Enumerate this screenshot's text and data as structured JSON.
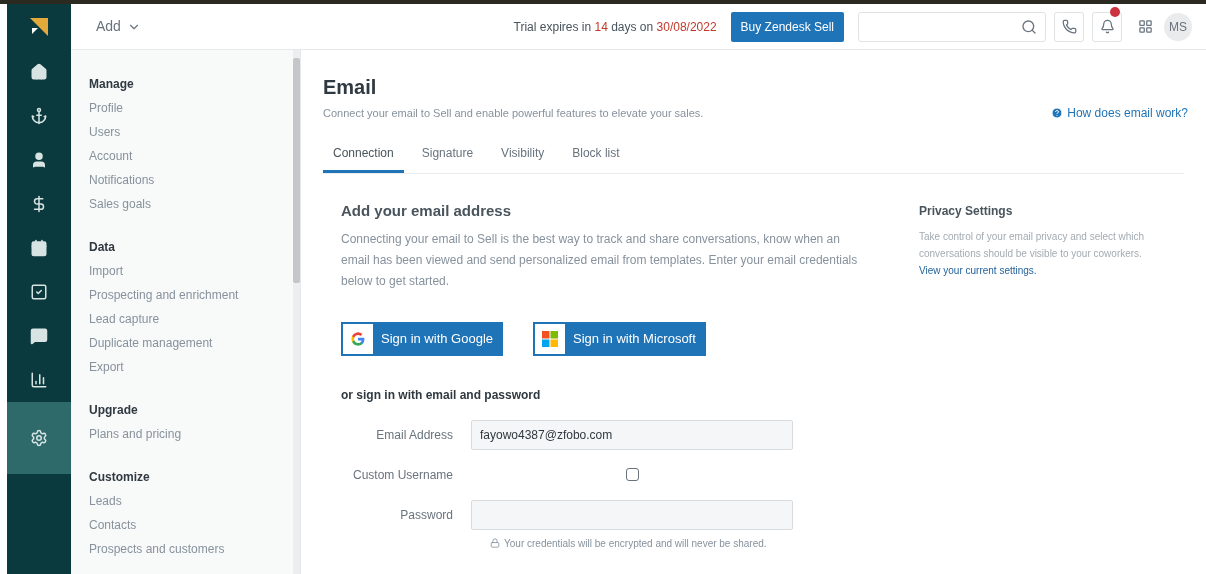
{
  "rail": [
    {
      "kind": "home",
      "selected": false
    },
    {
      "kind": "leads",
      "selected": false
    },
    {
      "kind": "contacts",
      "selected": false
    },
    {
      "kind": "deals",
      "selected": false
    },
    {
      "kind": "calendar",
      "selected": false
    },
    {
      "kind": "tasks",
      "selected": false
    },
    {
      "kind": "communication",
      "selected": false
    },
    {
      "kind": "reports",
      "selected": false
    },
    {
      "kind": "settings",
      "selected": true
    }
  ],
  "topbar": {
    "add": "Add",
    "trial": [
      {
        "text": "Trial expires in ",
        "highlight": false
      },
      {
        "text": "14",
        "highlight": true
      },
      {
        "text": " days on ",
        "highlight": false
      },
      {
        "text": "30/08/2022",
        "highlight": true
      }
    ],
    "buy": "Buy Zendesk Sell",
    "notification": true,
    "avatar": "MS"
  },
  "sidebar": [
    {
      "heading": "Manage",
      "items": [
        "Profile",
        "Users",
        "Account",
        "Notifications",
        "Sales goals"
      ]
    },
    {
      "heading": "Data",
      "items": [
        "Import",
        "Prospecting and enrichment",
        "Lead capture",
        "Duplicate management",
        "Export"
      ]
    },
    {
      "heading": "Upgrade",
      "items": [
        "Plans and pricing"
      ]
    },
    {
      "heading": "Customize",
      "items": [
        "Leads",
        "Contacts",
        "Prospects and customers"
      ]
    }
  ],
  "page": {
    "title": "Email",
    "subtitle": "Connect your email to Sell and enable powerful features to elevate your sales.",
    "help": "How does email work?",
    "tabs": [
      {
        "label": "Connection",
        "selected": true
      },
      {
        "label": "Signature",
        "selected": false
      },
      {
        "label": "Visibility",
        "selected": false
      },
      {
        "label": "Block list",
        "selected": false
      }
    ]
  },
  "connect": {
    "heading": "Add your email address",
    "text": "Connecting your email to Sell is the best way to track and share conversations, know when an email has been viewed and send personalized email from templates. Enter your email credentials below to get started.",
    "providers": [
      {
        "kind": "google",
        "label": "Sign in with Google"
      },
      {
        "kind": "microsoft",
        "label": "Sign in with Microsoft"
      }
    ],
    "alt": "or sign in with email and password",
    "email": {
      "label": "Email Address",
      "value": "fayowo4387@zfobo.com"
    },
    "custom_username": {
      "label": "Custom Username",
      "checked": false
    },
    "password": {
      "label": "Password"
    },
    "note": "Your credentials will be encrypted and will never be shared."
  },
  "privacy": {
    "heading": "Privacy Settings",
    "text": "Take control of your email privacy and select which conversations should be visible to your coworkers.",
    "link": "View your current settings."
  }
}
